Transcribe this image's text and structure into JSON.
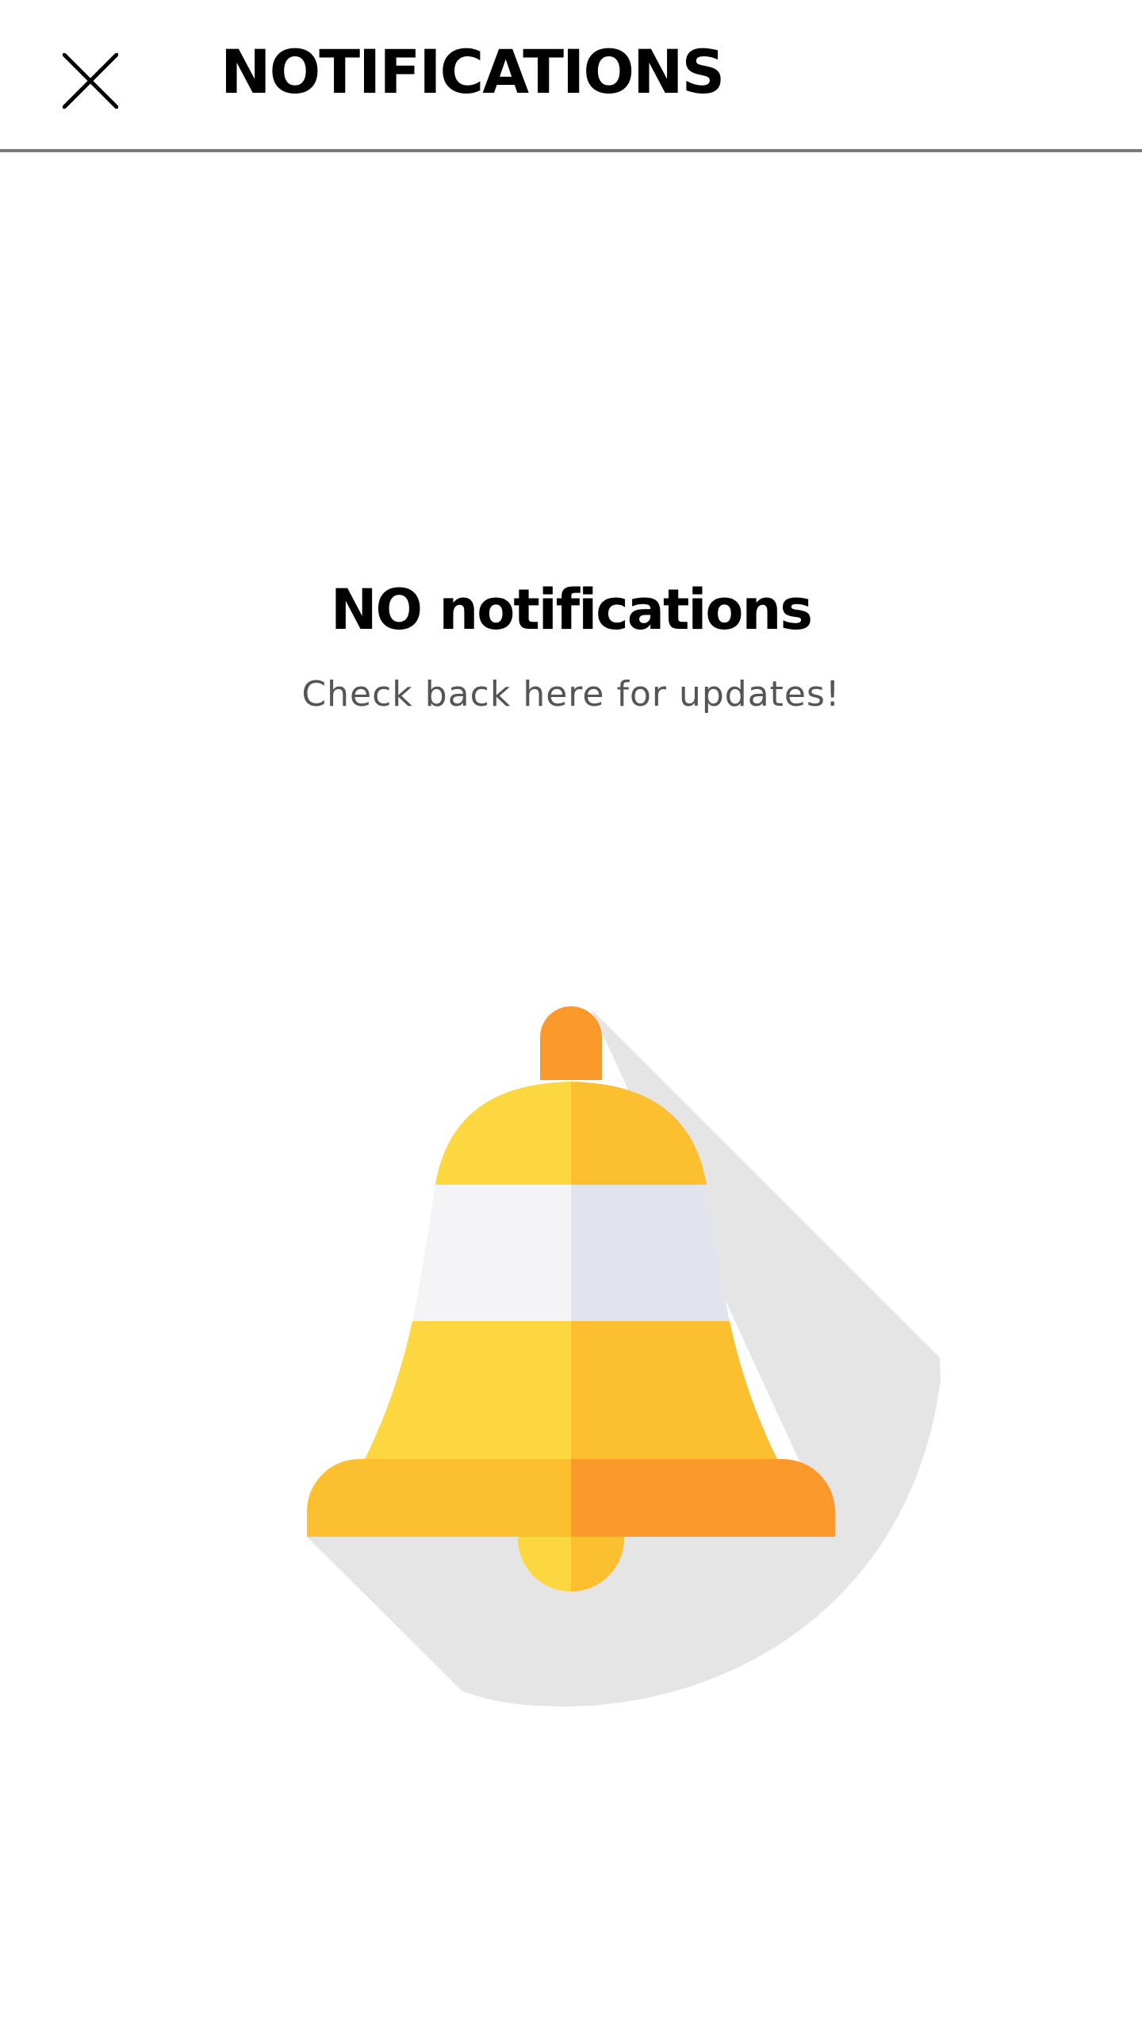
{
  "header": {
    "title": "NOTIFICATIONS",
    "close_icon": "close-icon"
  },
  "empty_state": {
    "title": "NO notifications",
    "subtitle": "Check back here for updates!",
    "illustration_icon": "bell-icon"
  },
  "colors": {
    "divider": "#7a7a7a",
    "bell_yellow_light": "#FDD73F",
    "bell_yellow_dark": "#FBBF30",
    "bell_orange": "#FB9A2A",
    "bell_band_light": "#F4F4F6",
    "bell_band_dark": "#E1E3ED",
    "shadow": "#E5E5E5"
  }
}
